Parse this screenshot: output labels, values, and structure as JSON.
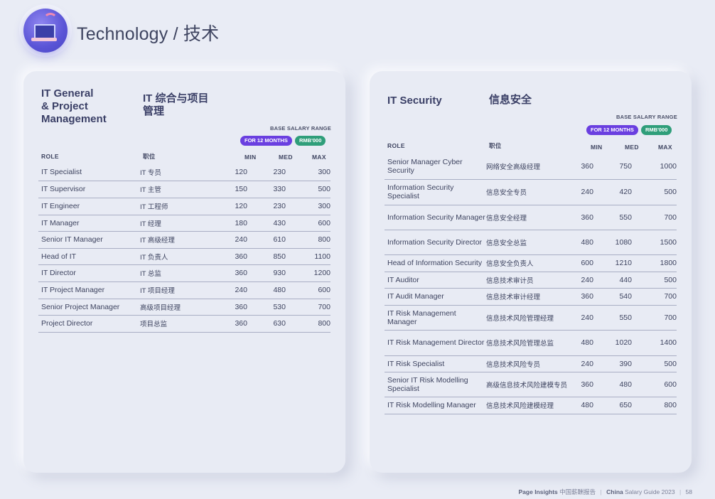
{
  "header": {
    "title": "Technology / 技术"
  },
  "badges": {
    "base_range": "BASE SALARY RANGE",
    "months": "FOR 12 MONTHS",
    "unit": "RMB'000"
  },
  "columns": {
    "role": "ROLE",
    "role_cn": "职位",
    "min": "MIN",
    "med": "MED",
    "max": "MAX"
  },
  "left": {
    "title_en_1": "IT General",
    "title_en_2": "& Project",
    "title_en_3": "Management",
    "title_cn_1": "IT 综合与项目",
    "title_cn_2": "管理",
    "rows": [
      {
        "role": "IT Specialist",
        "cn": "IT 专员",
        "min": "120",
        "med": "230",
        "max": "300"
      },
      {
        "role": "IT Supervisor",
        "cn": "IT 主管",
        "min": "150",
        "med": "330",
        "max": "500"
      },
      {
        "role": "IT Engineer",
        "cn": "IT 工程师",
        "min": "120",
        "med": "230",
        "max": "300"
      },
      {
        "role": "IT Manager",
        "cn": "IT 经理",
        "min": "180",
        "med": "430",
        "max": "600"
      },
      {
        "role": "Senior IT Manager",
        "cn": "IT 高级经理",
        "min": "240",
        "med": "610",
        "max": "800"
      },
      {
        "role": "Head of IT",
        "cn": "IT 负责人",
        "min": "360",
        "med": "850",
        "max": "1100"
      },
      {
        "role": "IT Director",
        "cn": "IT 总监",
        "min": "360",
        "med": "930",
        "max": "1200"
      },
      {
        "role": "IT Project Manager",
        "cn": "IT 项目经理",
        "min": "240",
        "med": "480",
        "max": "600"
      },
      {
        "role": "Senior Project Manager",
        "cn": "高级项目经理",
        "min": "360",
        "med": "530",
        "max": "700"
      },
      {
        "role": "Project Director",
        "cn": "项目总监",
        "min": "360",
        "med": "630",
        "max": "800"
      }
    ]
  },
  "right": {
    "title_en": "IT Security",
    "title_cn": "信息安全",
    "rows": [
      {
        "role": "Senior Manager Cyber Security",
        "cn": "网络安全高级经理",
        "min": "360",
        "med": "750",
        "max": "1000"
      },
      {
        "role": "Information Security Specialist",
        "cn": "信息安全专员",
        "min": "240",
        "med": "420",
        "max": "500"
      },
      {
        "role": "Information Security Manager",
        "cn": "信息安全经理",
        "min": "360",
        "med": "550",
        "max": "700"
      },
      {
        "role": "Information Security Director",
        "cn": "信息安全总监",
        "min": "480",
        "med": "1080",
        "max": "1500"
      },
      {
        "role": "Head of Information Security",
        "cn": "信息安全负责人",
        "min": "600",
        "med": "1210",
        "max": "1800"
      },
      {
        "role": "IT Auditor",
        "cn": "信息技术审计员",
        "min": "240",
        "med": "440",
        "max": "500"
      },
      {
        "role": "IT Audit Manager",
        "cn": "信息技术审计经理",
        "min": "360",
        "med": "540",
        "max": "700"
      },
      {
        "role": "IT Risk Management Manager",
        "cn": "信息技术风险管理经理",
        "min": "240",
        "med": "550",
        "max": "700"
      },
      {
        "role": "IT Risk Management Director",
        "cn": "信息技术风险管理总监",
        "min": "480",
        "med": "1020",
        "max": "1400"
      },
      {
        "role": "IT Risk Specialist",
        "cn": "信息技术风险专员",
        "min": "240",
        "med": "390",
        "max": "500"
      },
      {
        "role": "Senior IT Risk Modelling Specialist",
        "cn": "高级信息技术风险建模专员",
        "min": "360",
        "med": "480",
        "max": "600"
      },
      {
        "role": "IT Risk Modelling Manager",
        "cn": "信息技术风险建模经理",
        "min": "480",
        "med": "650",
        "max": "800"
      }
    ]
  },
  "footer": {
    "brand": "Page Insights",
    "brand_cn": "中国薪酬报告",
    "guide_bold": "China",
    "guide": "Salary Guide 2023",
    "page": "58"
  }
}
